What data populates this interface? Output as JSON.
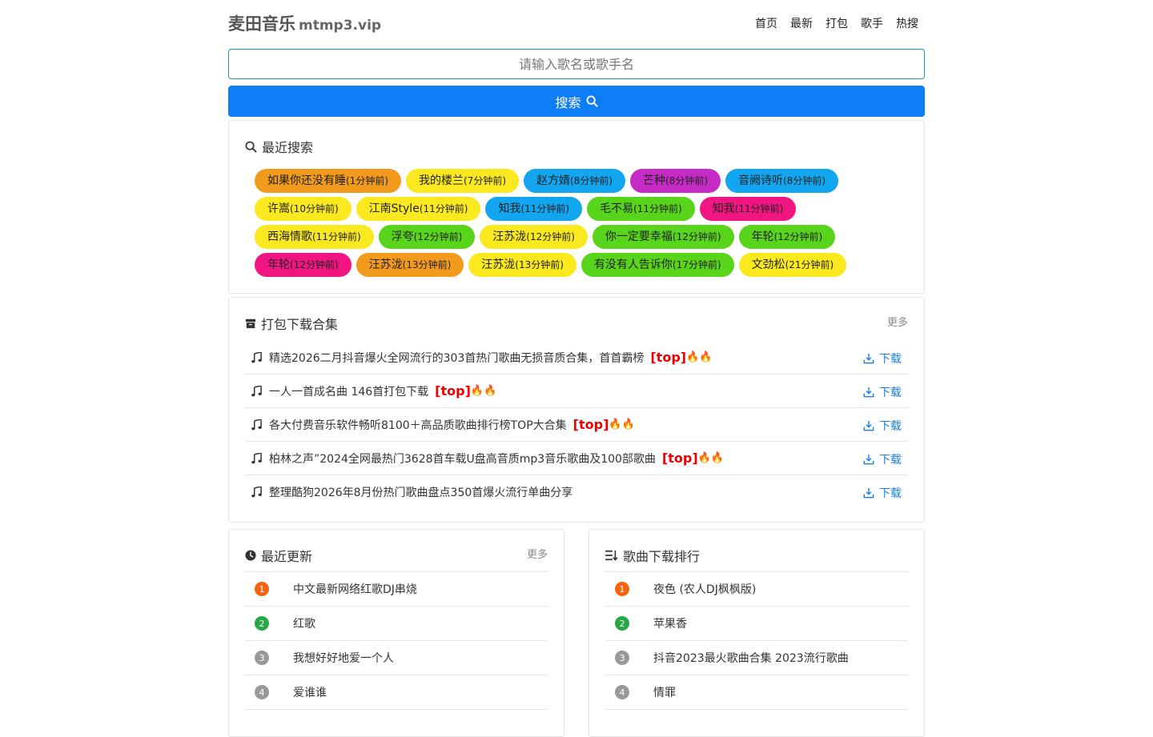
{
  "header": {
    "logo": "麦田音乐",
    "domain": "mtmp3.vip",
    "nav": [
      "首页",
      "最新",
      "打包",
      "歌手",
      "热搜"
    ]
  },
  "search": {
    "placeholder": "请输入歌名或歌手名",
    "button_label": "搜索"
  },
  "recent": {
    "title": "最近搜索",
    "tags": [
      {
        "name": "如果你还没有睡",
        "time": "(1分钟前)",
        "color": "#f29a1c"
      },
      {
        "name": "我的楼兰",
        "time": "(7分钟前)",
        "color": "#fbe91f"
      },
      {
        "name": "赵方婧",
        "time": "(8分钟前)",
        "color": "#12a6f0"
      },
      {
        "name": "芒种",
        "time": "(8分钟前)",
        "color": "#c62bc6"
      },
      {
        "name": "音阙诗听",
        "time": "(8分钟前)",
        "color": "#12a6f0"
      },
      {
        "name": "许嵩",
        "time": "(10分钟前)",
        "color": "#fbe91f"
      },
      {
        "name": "江南Style",
        "time": "(11分钟前)",
        "color": "#fbe91f"
      },
      {
        "name": "知我",
        "time": "(11分钟前)",
        "color": "#12a6f0"
      },
      {
        "name": "毛不易",
        "time": "(11分钟前)",
        "color": "#58d51a"
      },
      {
        "name": "知我",
        "time": "(11分钟前)",
        "color": "#f01580"
      },
      {
        "name": "西海情歌",
        "time": "(11分钟前)",
        "color": "#fbe91f"
      },
      {
        "name": "浮夸",
        "time": "(12分钟前)",
        "color": "#58d51a"
      },
      {
        "name": "汪苏泷",
        "time": "(12分钟前)",
        "color": "#fbe91f"
      },
      {
        "name": "你一定要幸福",
        "time": "(12分钟前)",
        "color": "#58d51a"
      },
      {
        "name": "年轮",
        "time": "(12分钟前)",
        "color": "#58d51a"
      },
      {
        "name": "年轮",
        "time": "(12分钟前)",
        "color": "#f01580"
      },
      {
        "name": "汪苏泷",
        "time": "(13分钟前)",
        "color": "#f29a1c"
      },
      {
        "name": "汪苏泷",
        "time": "(13分钟前)",
        "color": "#fbe91f"
      },
      {
        "name": "有没有人告诉你",
        "time": "(17分钟前)",
        "color": "#58d51a"
      },
      {
        "name": "文劲松",
        "time": "(21分钟前)",
        "color": "#fbe91f"
      }
    ]
  },
  "packs": {
    "title": "打包下载合集",
    "more": "更多",
    "download_label": "下载",
    "items": [
      {
        "title": "精选2026二月抖音爆火全网流行的303首热门歌曲无损音质合集，首首霸榜",
        "top": "[top]",
        "fire": "🔥🔥"
      },
      {
        "title": "一人一首成名曲 146首打包下载",
        "top": "[top]",
        "fire": "🔥🔥"
      },
      {
        "title": "各大付费音乐软件畅听8100＋高品质歌曲排行榜TOP大合集",
        "top": "[top]",
        "fire": "🔥🔥"
      },
      {
        "title": "柏林之声”2024全网最热门3628首车载U盘高音质mp3音乐歌曲及100部歌曲",
        "top": "[top]",
        "fire": "🔥🔥"
      },
      {
        "title": "整理酷狗2026年8月份热门歌曲盘点350首爆火流行单曲分享",
        "top": "",
        "fire": ""
      }
    ]
  },
  "updates": {
    "title": "最近更新",
    "more": "更多",
    "items": [
      {
        "rank": "1",
        "title": "中文最新网络红歌DJ串烧",
        "color": "#f4650f"
      },
      {
        "rank": "2",
        "title": "红歌",
        "color": "#28a745"
      },
      {
        "rank": "3",
        "title": "我想好好地爱一个人",
        "color": "#999999"
      },
      {
        "rank": "4",
        "title": "爱谁谁",
        "color": "#999999"
      }
    ]
  },
  "rank": {
    "title": "歌曲下载排行",
    "items": [
      {
        "rank": "1",
        "title": "夜色 (农人DJ枫枫版)",
        "color": "#f4650f"
      },
      {
        "rank": "2",
        "title": "苹果香",
        "color": "#28a745"
      },
      {
        "rank": "3",
        "title": "抖音2023最火歌曲合集 2023流行歌曲",
        "color": "#999999"
      },
      {
        "rank": "4",
        "title": "情罪",
        "color": "#999999"
      }
    ]
  }
}
